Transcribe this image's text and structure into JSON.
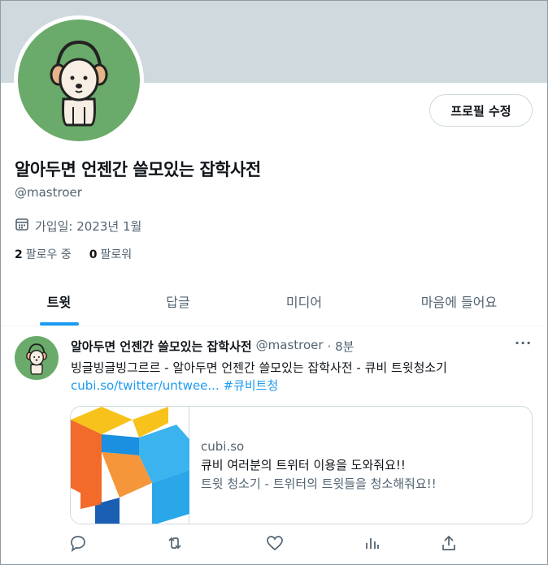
{
  "profile": {
    "name": "알아두면 언젠간 쓸모있는 잡학사전",
    "handle": "@mastroer",
    "joined": "가입일: 2023년 1월",
    "following_count": "2",
    "following_label": "팔로우 중",
    "followers_count": "0",
    "followers_label": "팔로워",
    "edit_label": "프로필 수정"
  },
  "tabs": [
    {
      "label": "트윗",
      "active": true
    },
    {
      "label": "답글",
      "active": false
    },
    {
      "label": "미디어",
      "active": false
    },
    {
      "label": "마음에 들어요",
      "active": false
    }
  ],
  "tweet": {
    "author": "알아두면 언젠간 쓸모있는 잡학사전",
    "handle": "@mastroer",
    "time": "· 8분",
    "more": "···",
    "text": "빙글빙글빙그르르 - 알아두면 언젠간 쓸모있는 잡학사전 - 큐비 트윗청소기",
    "link": "cubi.so/twitter/untwee...",
    "hashtag": "#큐비트청",
    "card": {
      "domain": "cubi.so",
      "title": "큐비 여러분의 트위터 이용을 도와줘요!!",
      "description": "트윗 청소기 - 트위터의 트윗들을 청소해줘요!!"
    }
  },
  "icons": {
    "calendar": "calendar-icon",
    "reply": "reply-icon",
    "retweet": "retweet-icon",
    "like": "like-icon",
    "views": "views-icon",
    "share": "share-icon"
  },
  "colors": {
    "accent": "#1d9bf0",
    "banner": "#cfd9de",
    "avatar_bg": "#6aaa6a"
  }
}
